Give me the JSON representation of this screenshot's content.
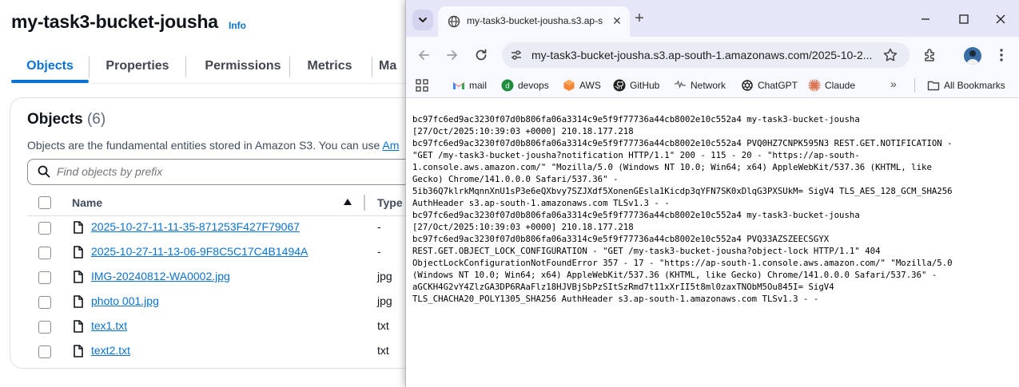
{
  "s3": {
    "bucket_title": "my-task3-bucket-jousha",
    "info_label": "Info",
    "tabs": [
      "Objects",
      "Properties",
      "Permissions",
      "Metrics",
      "Ma"
    ],
    "panel_title": "Objects",
    "panel_count": "(6)",
    "panel_desc_prefix": "Objects are the fundamental entities stored in Amazon S3. You can use ",
    "panel_desc_link": "Am",
    "search_placeholder": "Find objects by prefix",
    "col_name": "Name",
    "col_type": "Type",
    "rows": [
      {
        "name": "2025-10-27-11-11-35-871253F427F79067",
        "type": "-"
      },
      {
        "name": "2025-10-27-11-13-06-9F8C5C17C4B1494A",
        "type": "-"
      },
      {
        "name": "IMG-20240812-WA0002.jpg",
        "type": "jpg"
      },
      {
        "name": "photo 001.jpg",
        "type": "jpg"
      },
      {
        "name": "tex1.txt",
        "type": "txt"
      },
      {
        "name": "text2.txt",
        "type": "txt"
      }
    ]
  },
  "browser": {
    "tab_title": "my-task3-bucket-jousha.s3.ap-s",
    "url": "my-task3-bucket-jousha.s3.ap-south-1.amazonaws.com/2025-10-2...",
    "bookmarks": [
      "mail",
      "devops",
      "AWS",
      "GitHub",
      "Network",
      "ChatGPT",
      "Claude"
    ],
    "all_bookmarks": "All Bookmarks",
    "log": "bc97fc6ed9ac3230f07d0b806fa06a3314c9e5f9f77736a44cb8002e10c552a4 my-task3-bucket-jousha\n[27/Oct/2025:10:39:03 +0000] 210.18.177.218\nbc97fc6ed9ac3230f07d0b806fa06a3314c9e5f9f77736a44cb8002e10c552a4 PVQ0HZ7CNPK595N3 REST.GET.NOTIFICATION -\n\"GET /my-task3-bucket-jousha?notification HTTP/1.1\" 200 - 115 - 20 - \"https://ap-south-\n1.console.aws.amazon.com/\" \"Mozilla/5.0 (Windows NT 10.0; Win64; x64) AppleWebKit/537.36 (KHTML, like\nGecko) Chrome/141.0.0.0 Safari/537.36\" -\n5ib36Q7klrkMqnnXnU1sP3e6eQXbvy7SZJXdf5XonenGEsla1Kicdp3qYFN7SK0xDlqG3PXSUkM= SigV4 TLS_AES_128_GCM_SHA256\nAuthHeader s3.ap-south-1.amazonaws.com TLSv1.3 - -\nbc97fc6ed9ac3230f07d0b806fa06a3314c9e5f9f77736a44cb8002e10c552a4 my-task3-bucket-jousha\n[27/Oct/2025:10:39:03 +0000] 210.18.177.218\nbc97fc6ed9ac3230f07d0b806fa06a3314c9e5f9f77736a44cb8002e10c552a4 PVQ33AZSZEECSGYX\nREST.GET.OBJECT_LOCK_CONFIGURATION - \"GET /my-task3-bucket-jousha?object-lock HTTP/1.1\" 404\nObjectLockConfigurationNotFoundError 357 - 17 - \"https://ap-south-1.console.aws.amazon.com/\" \"Mozilla/5.0\n(Windows NT 10.0; Win64; x64) AppleWebKit/537.36 (KHTML, like Gecko) Chrome/141.0.0.0 Safari/537.36\" -\naGCKH4G2vY4ZlzGA3DP6RAaFlz18HJVBjSbPzSItSzRmd7t11xXrII5t8ml0zaxTNObM5Ou845I= SigV4\nTLS_CHACHA20_POLY1305_SHA256 AuthHeader s3.ap-south-1.amazonaws.com TLSv1.3 - -"
  }
}
